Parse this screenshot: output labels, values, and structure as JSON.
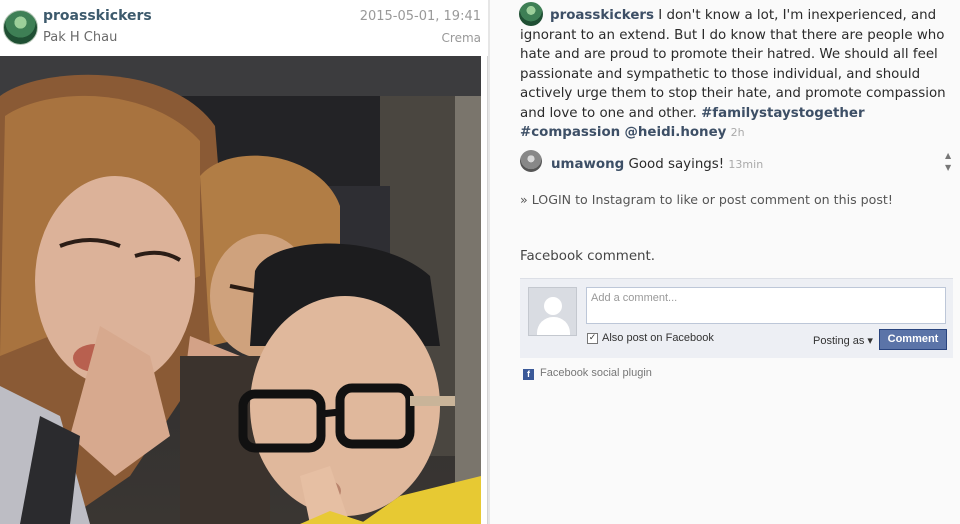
{
  "post": {
    "username": "proasskickers",
    "location": "Pak H Chau",
    "date": "2015-05-01, 19:41",
    "filter": "Crema"
  },
  "caption": {
    "username": "proasskickers",
    "text": " I don't know a lot, I'm inexperienced, and ignorant to an extend. But I do know that there are people who hate and are proud to promote their hatred. We should all feel passionate and sympathetic to those individual, and should actively urge them to stop their hate, and promote compassion and love to one and other. ",
    "tag1": "#familystaystogether",
    "tag2": "#compassion",
    "mention": "@heidi.honey",
    "time": "2h"
  },
  "comment": {
    "username": "umawong",
    "text": " Good sayings! ",
    "time": "13min"
  },
  "login_text": "» LOGIN to Instagram to like or post comment on this post!",
  "facebook": {
    "title": "Facebook comment.",
    "placeholder": "Add a comment...",
    "also_post": "Also post on Facebook",
    "posting_as": "Posting as ▾",
    "button": "Comment",
    "plugin": "Facebook social plugin"
  }
}
